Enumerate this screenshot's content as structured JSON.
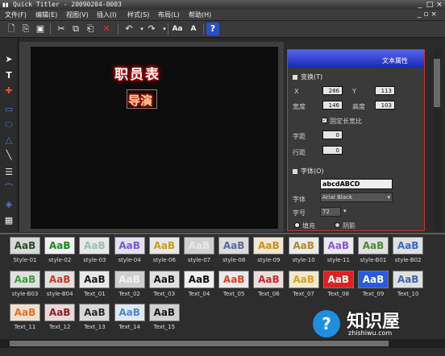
{
  "window": {
    "title": "Quick Titler - 20090204-0003",
    "controls": [
      "_",
      "□",
      "×"
    ]
  },
  "menu": [
    "文件(F)",
    "编辑(E)",
    "视图(V)",
    "插入(I)",
    "样式(S)",
    "布局(L)",
    "帮助(H)"
  ],
  "canvas": {
    "title_main": "职员表",
    "title_sub": "导演"
  },
  "properties": {
    "panel_title": "文本属性",
    "transform": {
      "section": "变换(T)",
      "x_label": "X",
      "x_value": "286",
      "y_label": "Y",
      "y_value": "113",
      "width_label": "宽度",
      "width_value": "146",
      "height_label": "高度",
      "height_value": "103",
      "lock_label": "固定长宽比",
      "tracking_label": "字距",
      "tracking_value": "0",
      "leading_label": "行距",
      "leading_value": "0"
    },
    "font": {
      "section": "字体(O)",
      "preview": "abcdABCD",
      "face_label": "字体",
      "face_value": "Arial Black",
      "size_label": "字号",
      "size_value": "72",
      "radio_left": "填充",
      "radio_right": "阴影"
    }
  },
  "styles": [
    {
      "text": "AaB",
      "label": "Style-01",
      "fg": "#2a4a2a",
      "bg": "#d8d8d8"
    },
    {
      "text": "AaB",
      "label": "style-02",
      "fg": "#1a8a1a",
      "bg": "#f0f0f0"
    },
    {
      "text": "AaB",
      "label": "style-03",
      "fg": "#9ac0b0",
      "bg": "#e8e8e8"
    },
    {
      "text": "AaB",
      "label": "style-04",
      "fg": "#7a5aca",
      "bg": "#e0e0f0"
    },
    {
      "text": "AaB",
      "label": "style-06",
      "fg": "#c8a020",
      "bg": "#e8e8e8"
    },
    {
      "text": "AaB",
      "label": "style-07",
      "fg": "#e8e8e8",
      "bg": "#d0d0d0"
    },
    {
      "text": "AaB",
      "label": "style-08",
      "fg": "#5a6a9a",
      "bg": "#dcdcdc"
    },
    {
      "text": "AaB",
      "label": "style-09",
      "fg": "#c89020",
      "bg": "#f0e8d0"
    },
    {
      "text": "AaB",
      "label": "style-10",
      "fg": "#b08a30",
      "bg": "#ececec"
    },
    {
      "text": "AaB",
      "label": "style-11",
      "fg": "#8a5ac8",
      "bg": "#e8e8f0"
    },
    {
      "text": "AaB",
      "label": "style-B01",
      "fg": "#4a8a3a",
      "bg": "#e0e0e0"
    },
    {
      "text": "AaB",
      "label": "style-B02",
      "fg": "#3a6ac8",
      "bg": "#e0e0e0"
    },
    {
      "text": "AaB",
      "label": "style-B03",
      "fg": "#3aa03a",
      "bg": "#e0e0e0"
    },
    {
      "text": "AaB",
      "label": "style-B04",
      "fg": "#c83a2a",
      "bg": "#e0e0e0"
    },
    {
      "text": "AaB",
      "label": "Text_01",
      "fg": "#1a1a1a",
      "bg": "#e8e8e8"
    },
    {
      "text": "AaB",
      "label": "Text_02",
      "fg": "#f0f0f0",
      "bg": "#cfcfcf"
    },
    {
      "text": "AaB",
      "label": "Text_03",
      "fg": "#1a1a1a",
      "bg": "#e0e0e0"
    },
    {
      "text": "AaB",
      "label": "Text_04",
      "fg": "#111111",
      "bg": "#f0f0f0"
    },
    {
      "text": "AaB",
      "label": "Text_05",
      "fg": "#e04020",
      "bg": "#eaeaea"
    },
    {
      "text": "AaB",
      "label": "Text_06",
      "fg": "#c82a2a",
      "bg": "#e8e0e0"
    },
    {
      "text": "AaB",
      "label": "Text_07",
      "fg": "#d8a020",
      "bg": "#f0e8d0"
    },
    {
      "text": "AaB",
      "label": "Text_08",
      "fg": "#ffffff",
      "bg": "#e02020"
    },
    {
      "text": "AaB",
      "label": "Text_09",
      "fg": "#ffffff",
      "bg": "#2a5ae0"
    },
    {
      "text": "AaB",
      "label": "Text_10",
      "fg": "#3a6aaa",
      "bg": "#e0e0e0"
    },
    {
      "text": "AaB",
      "label": "Text_11",
      "fg": "#e07020",
      "bg": "#f0e0d0"
    },
    {
      "text": "AaB",
      "label": "Text_12",
      "fg": "#8a2020",
      "bg": "#e8d8d8"
    },
    {
      "text": "AaB",
      "label": "Text_13",
      "fg": "#2a2a2a",
      "bg": "#d8d8d8"
    },
    {
      "text": "AaB",
      "label": "Text_14",
      "fg": "#4a8ac8",
      "bg": "#e0e8f0"
    },
    {
      "text": "AaB",
      "label": "Text_15",
      "fg": "#1a1a1a",
      "bg": "#d0d0d0"
    }
  ],
  "watermark": {
    "icon": "?",
    "text": "知识屋",
    "url": "zhishiwu.com"
  }
}
